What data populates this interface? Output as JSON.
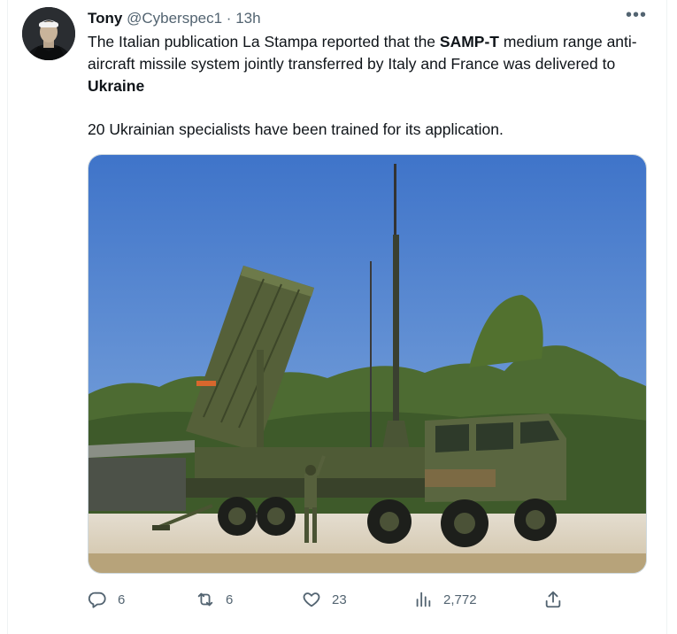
{
  "tweet": {
    "author_name": "Tony",
    "author_handle": "@Cyberspec1",
    "separator": "·",
    "time": "13h",
    "more_label": "•••",
    "text_part1": "The Italian publication La Stampa reported that the ",
    "text_bold1": "SAMP-T",
    "text_part2": " medium range anti-aircraft missile system jointly transferred by Italy and France was delivered to ",
    "text_bold2": "Ukraine",
    "paragraph2": "20 Ukrainian specialists have been trained for its application."
  },
  "actions": {
    "replies": "6",
    "retweets": "6",
    "likes": "23",
    "views": "2,772"
  },
  "icons": {
    "reply": "reply-icon",
    "retweet": "retweet-icon",
    "like": "heart-icon",
    "views": "views-chart-icon",
    "share": "share-icon",
    "more": "more-horizontal-icon"
  },
  "colors": {
    "text": "#0f1419",
    "secondary": "#536471",
    "border": "#cfd9de"
  }
}
